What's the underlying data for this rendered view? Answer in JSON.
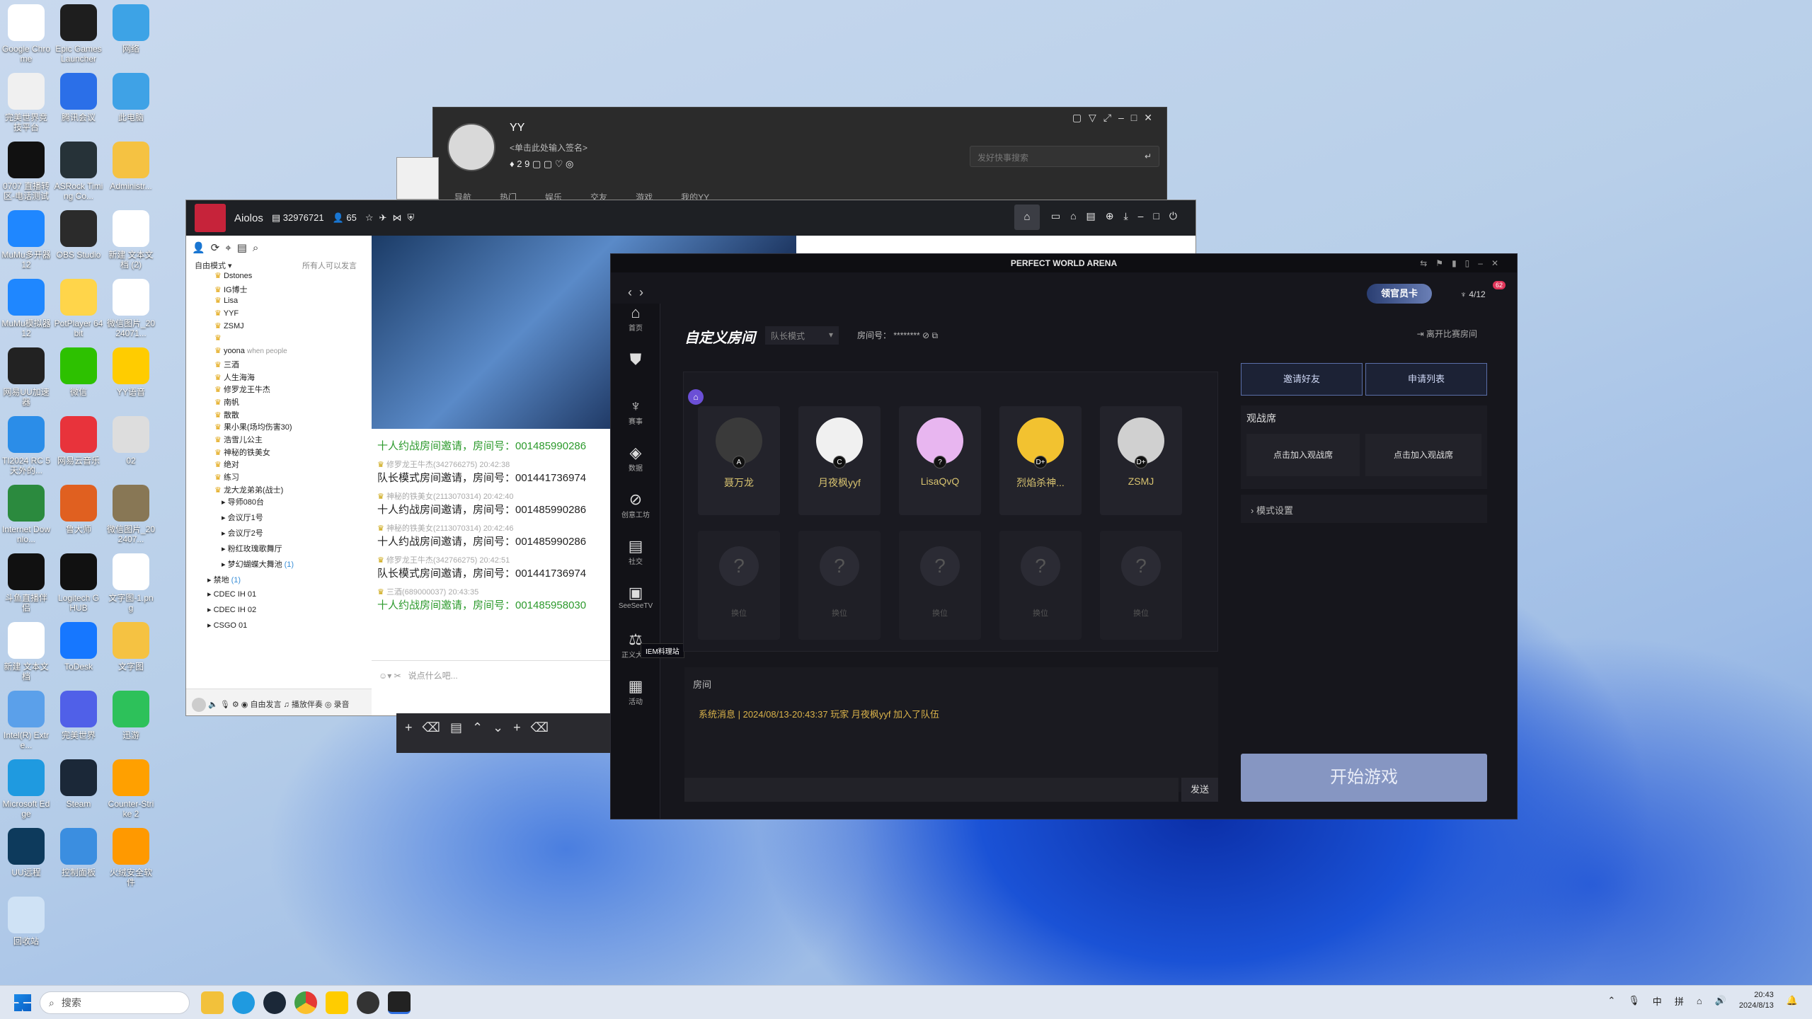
{
  "desktop_icons": [
    {
      "label": "Google Chrome",
      "color": "#ffffff"
    },
    {
      "label": "Epic Games Launcher",
      "color": "#1e1e1e"
    },
    {
      "label": "网络",
      "color": "#3da3e6"
    },
    {
      "label": "完美世界竞技平台",
      "color": "#f0f0f0"
    },
    {
      "label": "腾讯会议",
      "color": "#2b6fe8"
    },
    {
      "label": "此电脑",
      "color": "#3fa2e6"
    },
    {
      "label": "0707 直播转 区-电话测试",
      "color": "#111111"
    },
    {
      "label": "ASRock Timing Co...",
      "color": "#263238"
    },
    {
      "label": "Administr...",
      "color": "#f5c242"
    },
    {
      "label": "MuMu多开器12",
      "color": "#1f87ff"
    },
    {
      "label": "OBS Studio",
      "color": "#2b2b2b"
    },
    {
      "label": "新建 文本文档 (2)",
      "color": "#ffffff"
    },
    {
      "label": "MuMu模拟器12",
      "color": "#1f87ff"
    },
    {
      "label": "PotPlayer 64 bit",
      "color": "#ffd54a"
    },
    {
      "label": "微信图片_2024071...",
      "color": "#ffffff"
    },
    {
      "label": "网易UU加速器",
      "color": "#222222"
    },
    {
      "label": "微信",
      "color": "#2dc100"
    },
    {
      "label": "YY语音",
      "color": "#ffcc00"
    },
    {
      "label": "TI2024 RC 5天外的...",
      "color": "#2b8de8"
    },
    {
      "label": "网易云音乐",
      "color": "#e8333b"
    },
    {
      "label": "02",
      "color": "#dddddd"
    },
    {
      "label": "Internet Downlo...",
      "color": "#2b8a3e"
    },
    {
      "label": "鲁大师",
      "color": "#e06020"
    },
    {
      "label": "微信图片_202407...",
      "color": "#887755"
    },
    {
      "label": "斗鱼直播伴侣",
      "color": "#111111"
    },
    {
      "label": "Logitech G HUB",
      "color": "#111111"
    },
    {
      "label": "文字图-1.png",
      "color": "#ffffff"
    },
    {
      "label": "新建 文本文档",
      "color": "#ffffff"
    },
    {
      "label": "ToDesk",
      "color": "#1677ff"
    },
    {
      "label": "文字图",
      "color": "#f5c242"
    },
    {
      "label": "Intel(R) Extre...",
      "color": "#5ba0ea"
    },
    {
      "label": "完美世界",
      "color": "#5060e8"
    },
    {
      "label": "迅游",
      "color": "#2dc15a"
    },
    {
      "label": "Microsoft Edge",
      "color": "#1f9ae0"
    },
    {
      "label": "Steam",
      "color": "#1b2838"
    },
    {
      "label": "Counter-Strike 2",
      "color": "#ffa000"
    },
    {
      "label": "UU远程",
      "color": "#0d3a5c"
    },
    {
      "label": "控制面板",
      "color": "#3b8ee0"
    },
    {
      "label": "火绒安全软件",
      "color": "#ff9900"
    },
    {
      "label": "回收站",
      "color": "#cfe2f5"
    }
  ],
  "qq": {
    "name": "YY",
    "signature": "<单击此处输入签名>",
    "badges": "2 9 ",
    "search_placeholder": "发好快事搜索",
    "tabs": [
      "导航",
      "热门",
      "娱乐",
      "交友",
      "游戏",
      "我的YY"
    ]
  },
  "yy": {
    "channel": "Aiolos",
    "id": "32976721",
    "count": "65",
    "mode": "自由模式",
    "perm": "所有人可以发言",
    "members": [
      "Dstones",
      "IG博士",
      "Lisa",
      "YYF",
      "ZSMJ",
      "",
      "yoona",
      "三酒",
      "人生海海",
      "修罗龙王牛杰",
      "南帆",
      "散散",
      "果小果(场均伤害30)",
      "浩雪儿公主",
      "神秘的铁美女",
      "绝对",
      "练习",
      "龙大龙弟弟(战士)"
    ],
    "member_note": "when people",
    "subchannels": [
      "导师080台",
      "会议厅1号",
      "会议厅2号",
      "粉红玫瑰歌舞厅",
      "梦幻蝴蝶大舞池",
      "禁地",
      "CDEC IH 01",
      "CDEC IH 02",
      "CSGO 01"
    ],
    "subcount": "(1)",
    "subcount2": "(1)",
    "messages": [
      {
        "user": "",
        "time": "",
        "text": "十人约战房间邀请，房间号：001485990286",
        "green": true
      },
      {
        "user": "修罗龙王牛杰(342766275)",
        "time": "20:42:38",
        "text": "队长模式房间邀请，房间号：001441736974",
        "green": false
      },
      {
        "user": "神秘的铁美女(2113070314)",
        "time": "20:42:40",
        "text": "十人约战房间邀请，房间号：001485990286",
        "green": false
      },
      {
        "user": "神秘的铁美女(2113070314)",
        "time": "20:42:46",
        "text": "十人约战房间邀请，房间号：001485990286",
        "green": false
      },
      {
        "user": "修罗龙王牛杰(342766275)",
        "time": "20:42:51",
        "text": "队长模式房间邀请，房间号：001441736974",
        "green": false
      },
      {
        "user": "三酒(689000037)",
        "time": "20:43:35",
        "text": "十人约战房间邀请，房间号：001485958030",
        "green": true
      }
    ],
    "input_placeholder": "说点什么吧...",
    "bottom_free": "自由发言",
    "bottom_play": "播放伴奏",
    "bottom_rec": "录音"
  },
  "pwa": {
    "title": "PERFECT WORLD ARENA",
    "badge": "领官员卡",
    "count": "4/12",
    "notif": "62",
    "room_title": "自定义房间",
    "mode": "队长模式",
    "room_label": "房间号：",
    "room_no": "********",
    "leave": "离开比赛房间",
    "nav": [
      "首页",
      "",
      "赛事",
      "数据",
      "创意工坊",
      "社交",
      "SeeSeeTV",
      "正义大厅",
      "活动"
    ],
    "tag": "IEM料理站",
    "players": [
      {
        "name": "聂万龙",
        "rank": "A",
        "color": "#3a3a3a"
      },
      {
        "name": "月夜枫yyf",
        "rank": "C",
        "color": "#f0f0f0"
      },
      {
        "name": "LisaQvQ",
        "rank": "?",
        "color": "#e8b6f0"
      },
      {
        "name": "烈焰杀神...",
        "rank": "D+",
        "color": "#f2c230"
      },
      {
        "name": "ZSMJ",
        "rank": "D+",
        "color": "#d0d0d0"
      }
    ],
    "empty_label": "换位",
    "empty_mark": "?",
    "invite": "邀请好友",
    "apply": "申请列表",
    "watch": "观战席",
    "join_watch": "点击加入观战席",
    "mode_settings": "模式设置",
    "chat_tab": "房间",
    "system_msg": "系统消息 | 2024/08/13-20:43:37 玩家 月夜枫yyf 加入了队伍",
    "send": "发送",
    "start": "开始游戏"
  },
  "taskbar": {
    "search": "搜索",
    "ime": "中",
    "ime2": "拼",
    "time": "20:43",
    "date": "2024/8/13"
  }
}
